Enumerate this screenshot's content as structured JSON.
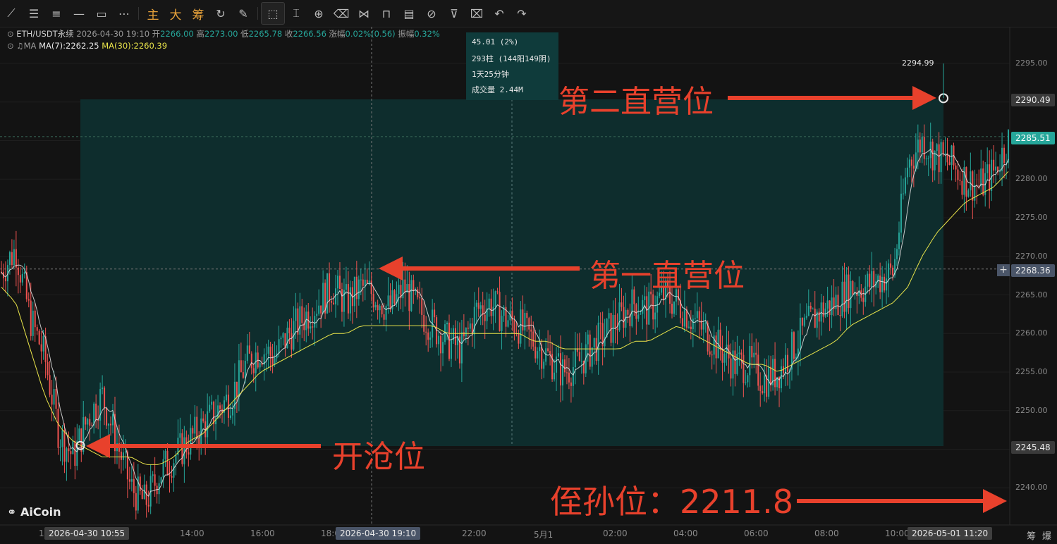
{
  "toolbar": {
    "icons": [
      "line-tool-icon",
      "parallel-lines-icon",
      "horizontal-lines-icon",
      "horizontal-ray-icon",
      "rectangle-icon",
      "more-tools-icon"
    ],
    "labels": [
      "主",
      "大",
      "筹"
    ],
    "icons2": [
      "replay-icon",
      "brush-icon",
      "cursor-select-icon",
      "ruler-icon",
      "zoom-alert-icon",
      "eraser-icon",
      "pattern-icon",
      "lock-icon",
      "template-icon",
      "hide-icon",
      "filter-icon",
      "trash-icon",
      "undo-icon",
      "redo-icon"
    ]
  },
  "info": {
    "symbol": "ETH/USDT永续",
    "datetime": "2026-04-30 19:10",
    "open_label": "开",
    "open": "2266.00",
    "high_label": "高",
    "high": "2273.00",
    "low_label": "低",
    "low": "2265.78",
    "close_label": "收",
    "close": "2266.56",
    "change_label": "涨幅",
    "change": "0.02%(0.56)",
    "amp_label": "振幅",
    "amp": "0.32%",
    "ma_label": "MA",
    "ma7": "MA(7):2262.25",
    "ma30": "MA(30):2260.39"
  },
  "measure": {
    "line1": "45.01 (2%)",
    "line2": "293柱 (144阳149阴)",
    "line3": "1天25分钟",
    "line4": "成交量 2.44M"
  },
  "price_axis": [
    "2295.00",
    "2290.00",
    "2285.00",
    "2280.00",
    "2275.00",
    "2270.00",
    "2265.00",
    "2260.00",
    "2255.00",
    "2250.00",
    "2245.00",
    "2240.00"
  ],
  "price_tags": {
    "high_point": "2294.99",
    "second_level": "2290.49",
    "current": "2285.51",
    "crosshair": "2268.36",
    "box_bottom": "2245.48"
  },
  "time_axis": [
    "10",
    "14:00",
    "16:00",
    "18:0",
    "22:00",
    "5月1",
    "02:00",
    "04:00",
    "06:00",
    "08:00",
    "10:00"
  ],
  "time_tags": {
    "left": "2026-04-30 10:55",
    "cross": "2026-04-30 19:10",
    "right": "2026-05-01 11:20"
  },
  "annotations": {
    "second": "第二直营位",
    "first": "第一直营位",
    "open": "开沧位",
    "stop": "侄孙位：2211.8"
  },
  "logo": "AiCoin",
  "right_buttons": [
    "筹",
    "爆"
  ],
  "colors": {
    "up": "#26a69a",
    "down": "#ef5350",
    "ma7": "#e6e6e6",
    "ma30": "#e8e34a",
    "box": "#0e2e2e",
    "arrow": "#e8412c"
  },
  "chart_data": {
    "type": "candlestick",
    "symbol": "ETH/USDT永续",
    "ylim": [
      2236,
      2298
    ],
    "x_range": [
      "2026-04-30 10:00",
      "2026-05-01 11:40"
    ],
    "key_points": [
      {
        "x": "2026-04-30 10:55",
        "y": 2245.48,
        "label": "开沧位"
      },
      {
        "x": "2026-05-01 11:20",
        "y": 2290.49,
        "label": "第二直营位"
      },
      {
        "x": "2026-04-30 19:10",
        "y": 2268.36,
        "label": "第一直营位"
      }
    ],
    "path_close": [
      2268,
      2271,
      2262,
      2257,
      2247,
      2244,
      2249,
      2252,
      2246,
      2240,
      2238,
      2242,
      2244,
      2246,
      2248,
      2250,
      2252,
      2256,
      2258,
      2257,
      2260,
      2262,
      2264,
      2266,
      2264,
      2266,
      2265,
      2263,
      2266,
      2263,
      2261,
      2259,
      2258,
      2263,
      2264,
      2262,
      2261,
      2259,
      2257,
      2255,
      2256,
      2258,
      2260,
      2262,
      2264,
      2263,
      2265,
      2264,
      2262,
      2260,
      2258,
      2256,
      2256,
      2254,
      2255,
      2258,
      2261,
      2263,
      2264,
      2266,
      2266,
      2267,
      2268,
      2282,
      2285,
      2283,
      2282,
      2280,
      2279,
      2281,
      2285
    ],
    "ma30": [
      2266,
      2264,
      2258,
      2252,
      2248,
      2246,
      2245,
      2244,
      2244,
      2244,
      2243,
      2243,
      2244,
      2246,
      2247,
      2249,
      2251,
      2253,
      2255,
      2256,
      2257,
      2258,
      2259,
      2260,
      2260,
      2261,
      2261,
      2261,
      2261,
      2261,
      2261,
      2260,
      2260,
      2260,
      2260,
      2260,
      2260,
      2259,
      2259,
      2258,
      2258,
      2258,
      2258,
      2258,
      2259,
      2259,
      2260,
      2261,
      2260,
      2259,
      2258,
      2257,
      2256,
      2256,
      2255,
      2256,
      2257,
      2258,
      2259,
      2261,
      2262,
      2263,
      2264,
      2266,
      2270,
      2273,
      2275,
      2277,
      2278,
      2279,
      2281
    ]
  }
}
